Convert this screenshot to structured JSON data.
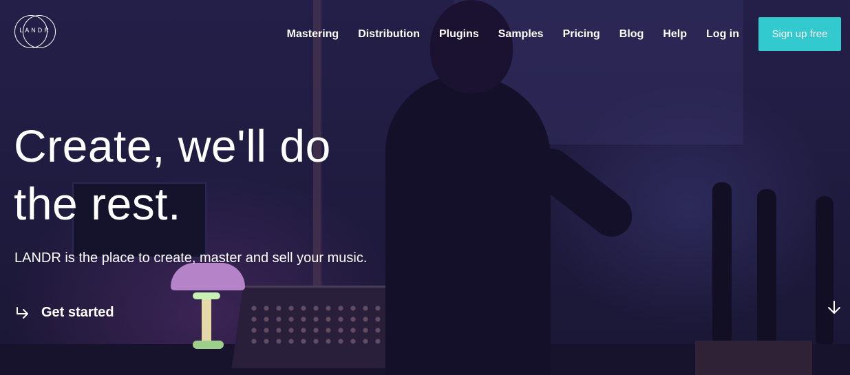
{
  "logo": {
    "text": "LANDR"
  },
  "nav": {
    "items": [
      {
        "label": "Mastering"
      },
      {
        "label": "Distribution"
      },
      {
        "label": "Plugins"
      },
      {
        "label": "Samples"
      },
      {
        "label": "Pricing"
      },
      {
        "label": "Blog"
      },
      {
        "label": "Help"
      },
      {
        "label": "Log in"
      }
    ],
    "signup_label": "Sign up free"
  },
  "hero": {
    "headline_line1": "Create, we'll do",
    "headline_line2": "the rest.",
    "subline": "LANDR is the place to create, master and sell your music.",
    "cta_label": "Get started",
    "cta_icon": "arrow-right-icon",
    "scroll_icon": "arrow-down-icon"
  },
  "colors": {
    "accent": "#32c9cf",
    "background": "#1e1a3d",
    "text": "#ffffff"
  }
}
